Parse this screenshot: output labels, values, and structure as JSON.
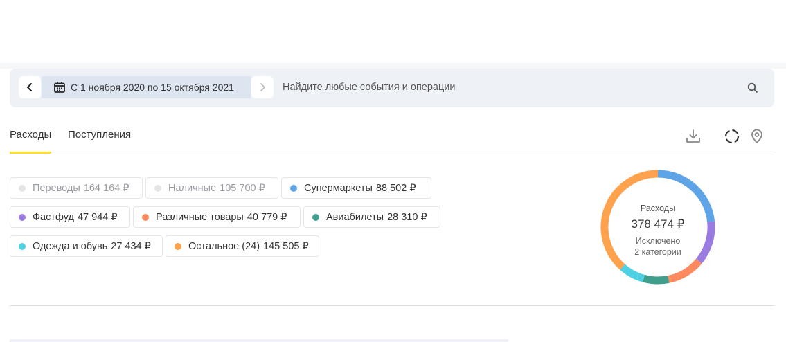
{
  "date_range": {
    "label": "С 1 ноября 2020 по 15 октября 2021"
  },
  "search": {
    "placeholder": "Найдите любые события и операции"
  },
  "tabs": [
    {
      "label": "Расходы",
      "active": true
    },
    {
      "label": "Поступления",
      "active": false
    }
  ],
  "icons": {
    "prev": "chevron-left-icon",
    "next": "chevron-right-icon",
    "calendar": "calendar-icon",
    "search": "search-icon",
    "download": "download-icon",
    "loading": "loading-icon",
    "location": "map-pin-icon"
  },
  "categories": [
    {
      "name": "Переводы",
      "amount": "164 164 ₽",
      "color": "#e3e5e8",
      "excluded": true
    },
    {
      "name": "Наличные",
      "amount": "105 700 ₽",
      "color": "#e3e5e8",
      "excluded": true
    },
    {
      "name": "Супермаркеты",
      "amount": "88 502 ₽",
      "color": "#5ea4e6",
      "excluded": false
    },
    {
      "name": "Фастфуд",
      "amount": "47 944 ₽",
      "color": "#9a7be0",
      "excluded": false
    },
    {
      "name": "Различные товары",
      "amount": "40 779 ₽",
      "color": "#fd8a5e",
      "excluded": false
    },
    {
      "name": "Авиабилеты",
      "amount": "28 310 ₽",
      "color": "#3f9e8c",
      "excluded": false
    },
    {
      "name": "Одежда и обувь",
      "amount": "27 434 ₽",
      "color": "#4fd0e3",
      "excluded": false
    },
    {
      "name": "Остальное (24)",
      "amount": "145 505 ₽",
      "color": "#ffa24d",
      "excluded": false
    }
  ],
  "summary": {
    "title": "Расходы",
    "total": "378 474 ₽",
    "note_line1": "Исключено",
    "note_line2": "2 категории"
  },
  "chart_data": {
    "type": "pie",
    "title": "Расходы",
    "categories": [
      "Супермаркеты",
      "Фастфуд",
      "Различные товары",
      "Авиабилеты",
      "Одежда и обувь",
      "Остальное (24)"
    ],
    "values": [
      88502,
      47944,
      40779,
      28310,
      27434,
      145505
    ],
    "colors": [
      "#5ea4e6",
      "#9a7be0",
      "#fd8a5e",
      "#3f9e8c",
      "#4fd0e3",
      "#ffa24d"
    ]
  }
}
